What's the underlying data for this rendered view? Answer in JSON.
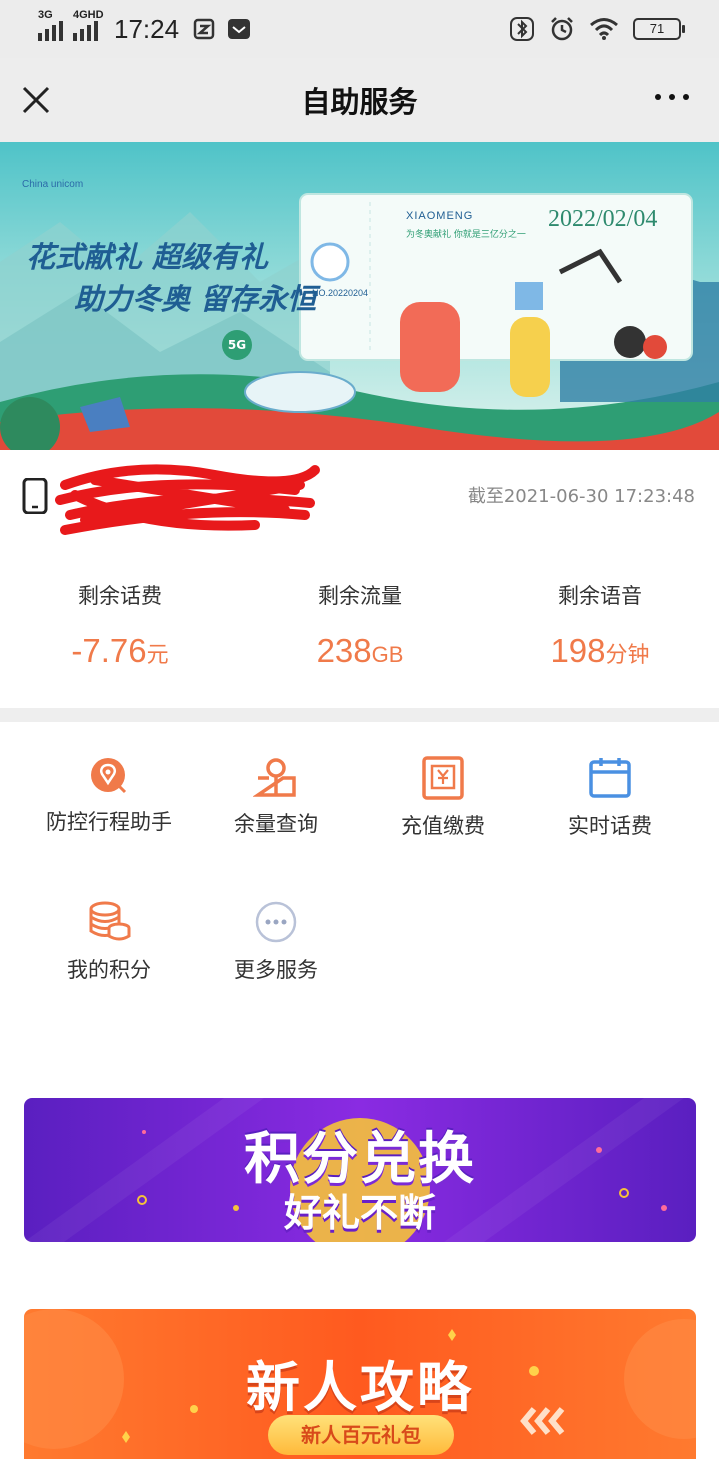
{
  "status_bar": {
    "network1": "3G",
    "network2": "4GHD",
    "time": "17:24",
    "battery": "71"
  },
  "nav": {
    "title": "自助服务"
  },
  "banner": {
    "slogan_line1": "花式献礼 超级有礼",
    "slogan_line2": "助力冬奥 留存永恒",
    "ticket_name": "XIAOMENG",
    "ticket_sub": "为冬奥献礼 你就是三亿分之一",
    "ticket_date": "2022/02/04",
    "ticket_no": "NO.20220204",
    "badge_5g": "5G"
  },
  "account": {
    "as_of": "截至2021-06-30 17:23:48",
    "stats": [
      {
        "label": "剩余话费",
        "value": "-7.76",
        "unit": "元"
      },
      {
        "label": "剩余流量",
        "value": "238",
        "unit": "GB"
      },
      {
        "label": "剩余语音",
        "value": "198",
        "unit": "分钟"
      }
    ]
  },
  "services": [
    {
      "label": "防控行程助手",
      "icon": "location-pin-icon"
    },
    {
      "label": "余量查询",
      "icon": "balance-query-icon"
    },
    {
      "label": "充值缴费",
      "icon": "recharge-icon"
    },
    {
      "label": "实时话费",
      "icon": "calendar-icon"
    },
    {
      "label": "我的积分",
      "icon": "coins-icon"
    },
    {
      "label": "更多服务",
      "icon": "more-dots-icon"
    }
  ],
  "promos": [
    {
      "title": "积分兑换",
      "subtitle": "好礼不断"
    },
    {
      "title": "新人攻略",
      "button": "新人百元礼包"
    }
  ],
  "colors": {
    "accent": "#f07a4a",
    "calendar_blue": "#4a90e2",
    "promo1": "#7b2bd6",
    "promo2": "#ff6a2a"
  }
}
